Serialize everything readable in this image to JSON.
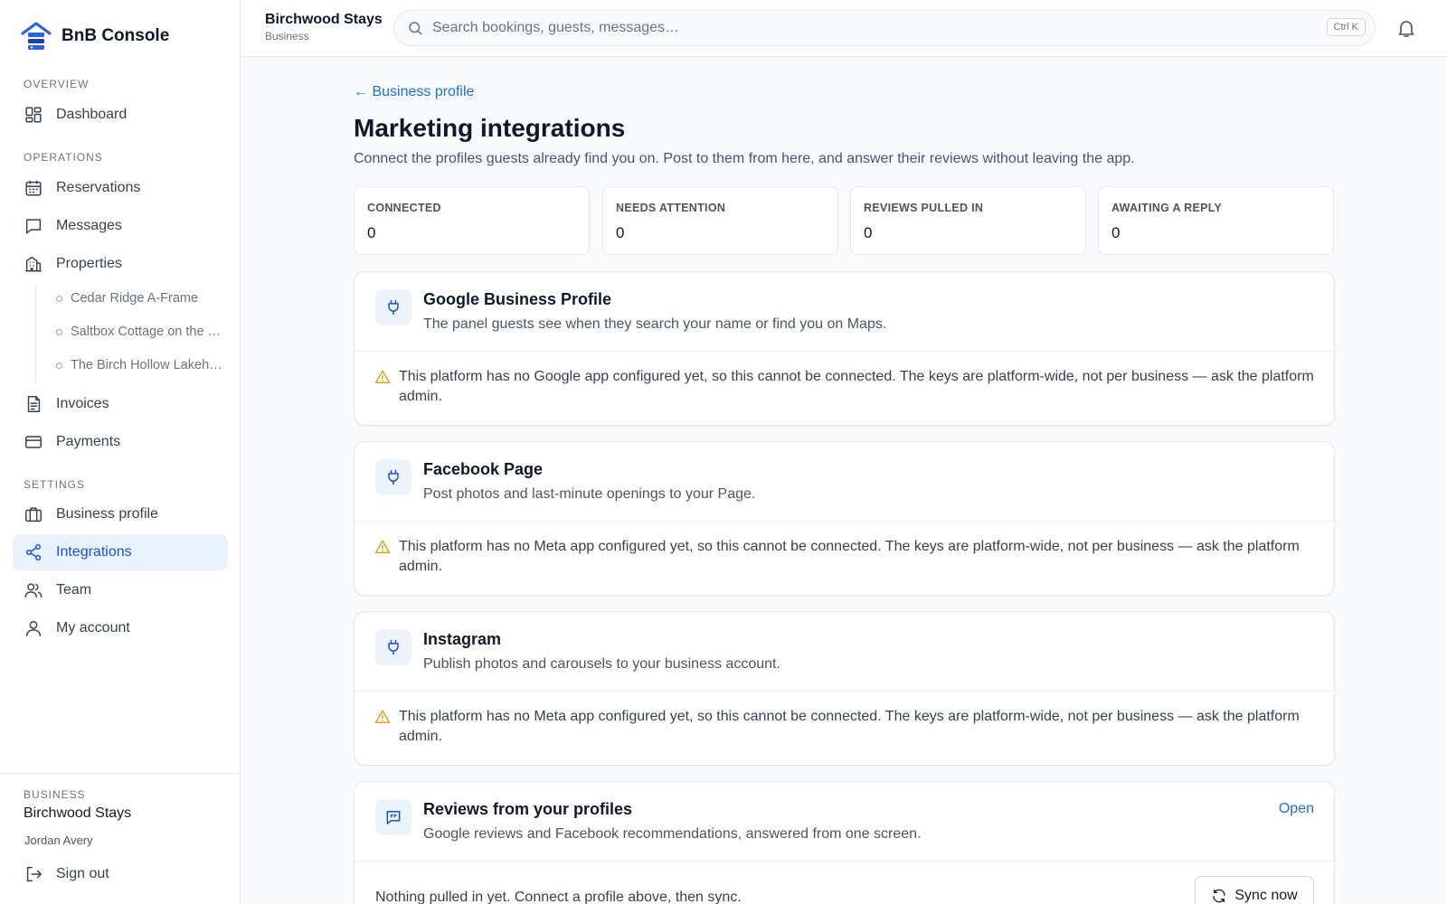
{
  "brand": {
    "name": "BnB Console"
  },
  "sidebar": {
    "sections": {
      "overview": "OVERVIEW",
      "operations": "OPERATIONS",
      "settings": "SETTINGS"
    },
    "items": {
      "dashboard": "Dashboard",
      "reservations": "Reservations",
      "messages": "Messages",
      "properties": "Properties",
      "invoices": "Invoices",
      "payments": "Payments",
      "business_profile": "Business profile",
      "integrations": "Integrations",
      "team": "Team",
      "my_account": "My account"
    },
    "properties": [
      "Cedar Ridge A-Frame",
      "Saltbox Cottage on the …",
      "The Birch Hollow Lakeh…"
    ],
    "active_item": "integrations",
    "footer": {
      "label": "BUSINESS",
      "business": "Birchwood Stays",
      "user": "Jordan Avery",
      "sign_out": "Sign out"
    }
  },
  "topbar": {
    "business": "Birchwood Stays",
    "business_sub": "Business",
    "search_placeholder": "Search bookings, guests, messages…",
    "shortcut": "Ctrl K"
  },
  "main": {
    "back": "← Business profile",
    "title": "Marketing integrations",
    "description": "Connect the profiles guests already find you on. Post to them from here, and answer their reviews without leaving the app.",
    "stats": [
      {
        "label": "CONNECTED",
        "value": "0"
      },
      {
        "label": "NEEDS ATTENTION",
        "value": "0"
      },
      {
        "label": "REVIEWS PULLED IN",
        "value": "0"
      },
      {
        "label": "AWAITING A REPLY",
        "value": "0"
      }
    ],
    "integrations": [
      {
        "title": "Google Business Profile",
        "subtitle": "The panel guests see when they search your name or find you on Maps.",
        "warning": "This platform has no Google app configured yet, so this cannot be connected. The keys are platform-wide, not per business — ask the platform admin."
      },
      {
        "title": "Facebook Page",
        "subtitle": "Post photos and last-minute openings to your Page.",
        "warning": "This platform has no Meta app configured yet, so this cannot be connected. The keys are platform-wide, not per business — ask the platform admin."
      },
      {
        "title": "Instagram",
        "subtitle": "Publish photos and carousels to your business account.",
        "warning": "This platform has no Meta app configured yet, so this cannot be connected. The keys are platform-wide, not per business — ask the platform admin."
      }
    ],
    "reviews": {
      "title": "Reviews from your profiles",
      "subtitle": "Google reviews and Facebook recommendations, answered from one screen.",
      "open": "Open",
      "empty": "Nothing pulled in yet. Connect a profile above, then sync.",
      "sync": "Sync now"
    }
  },
  "colors": {
    "accent": "#1d6fd8",
    "active_bg": "#e9f1fc",
    "warning": "#e0a21b"
  }
}
